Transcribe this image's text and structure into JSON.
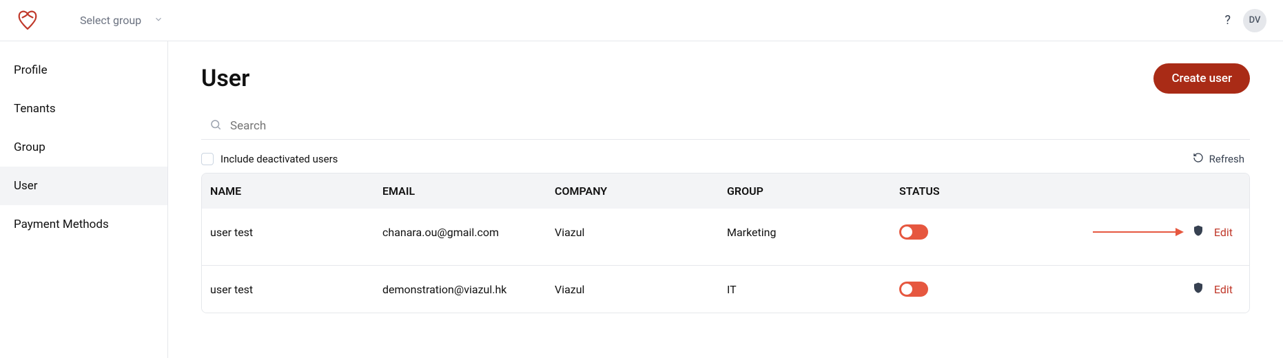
{
  "header": {
    "group_selector_label": "Select group",
    "help_icon": "?",
    "avatar_initials": "DV"
  },
  "sidebar": {
    "items": [
      {
        "label": "Profile",
        "active": false
      },
      {
        "label": "Tenants",
        "active": false
      },
      {
        "label": "Group",
        "active": false
      },
      {
        "label": "User",
        "active": true
      },
      {
        "label": "Payment Methods",
        "active": false
      }
    ]
  },
  "page": {
    "title": "User",
    "create_button_label": "Create user",
    "search_placeholder": "Search",
    "include_deactivated_label": "Include deactivated users",
    "include_deactivated_checked": false,
    "refresh_label": "Refresh"
  },
  "table": {
    "columns": {
      "name": "NAME",
      "email": "EMAIL",
      "company": "COMPANY",
      "group": "GROUP",
      "status": "STATUS"
    },
    "rows": [
      {
        "name": "user test",
        "email": "chanara.ou@gmail.com",
        "company": "Viazul",
        "group": "Marketing",
        "status_on": true,
        "edit_label": "Edit",
        "annotated": true
      },
      {
        "name": "user test",
        "email": "demonstration@viazul.hk",
        "company": "Viazul",
        "group": "IT",
        "status_on": true,
        "edit_label": "Edit",
        "annotated": false
      }
    ]
  },
  "colors": {
    "brand_red": "#c0392b",
    "create_btn_bg": "#a92b16",
    "toggle_bg": "#e6573f"
  }
}
